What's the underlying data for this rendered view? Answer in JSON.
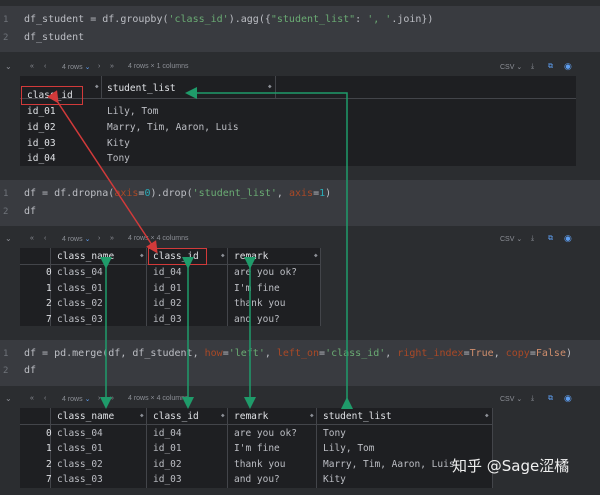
{
  "cell1": {
    "lines": [
      {
        "num": "1",
        "parts": [
          [
            "df_student = df.groupby(",
            ""
          ],
          [
            "'class_id'",
            "str"
          ],
          [
            ").agg({",
            ""
          ],
          [
            "\"student_list\"",
            "str"
          ],
          [
            ": ",
            ""
          ],
          [
            "', '",
            "str"
          ],
          [
            ".join})",
            ""
          ]
        ]
      },
      {
        "num": "2",
        "parts": [
          [
            "df_student",
            ""
          ]
        ]
      }
    ]
  },
  "out1": {
    "rows_label": "4 rows",
    "shape_label": "4 rows × 1 columns",
    "csv_label": "CSV",
    "index_header": "class_id",
    "columns": [
      "student_list"
    ],
    "rows": [
      {
        "index": "id_01",
        "cells": [
          "Lily, Tom"
        ]
      },
      {
        "index": "id_02",
        "cells": [
          "Marry, Tim, Aaron, Luis"
        ]
      },
      {
        "index": "id_03",
        "cells": [
          "Kity"
        ]
      },
      {
        "index": "id_04",
        "cells": [
          "Tony"
        ]
      }
    ]
  },
  "cell2": {
    "lines": [
      {
        "num": "1",
        "parts": [
          [
            "df = df.dropna(",
            ""
          ],
          [
            "axis",
            "kwarg"
          ],
          [
            "=",
            ""
          ],
          [
            "0",
            "num"
          ],
          [
            ").drop(",
            ""
          ],
          [
            "'student_list'",
            "str"
          ],
          [
            ", ",
            ""
          ],
          [
            "axis",
            "kwarg"
          ],
          [
            "=",
            ""
          ],
          [
            "1",
            "num"
          ],
          [
            ")",
            ""
          ]
        ]
      },
      {
        "num": "2",
        "parts": [
          [
            "df",
            ""
          ]
        ]
      }
    ]
  },
  "out2": {
    "rows_label": "4 rows",
    "shape_label": "4 rows × 4 columns",
    "csv_label": "CSV",
    "columns": [
      "class_name",
      "class_id",
      "remark"
    ],
    "rows": [
      {
        "index": "0",
        "cells": [
          "class_04",
          "id_04",
          "are you ok?"
        ]
      },
      {
        "index": "1",
        "cells": [
          "class_01",
          "id_01",
          "I'm fine"
        ]
      },
      {
        "index": "2",
        "cells": [
          "class_02",
          "id_02",
          "thank you"
        ]
      },
      {
        "index": "7",
        "cells": [
          "class_03",
          "id_03",
          "and you?"
        ]
      }
    ]
  },
  "cell3": {
    "lines": [
      {
        "num": "1",
        "parts": [
          [
            "df = pd.merge(df, df_student, ",
            ""
          ],
          [
            "how",
            "kwarg"
          ],
          [
            "=",
            ""
          ],
          [
            "'left'",
            "str"
          ],
          [
            ", ",
            ""
          ],
          [
            "left_on",
            "kwarg"
          ],
          [
            "=",
            ""
          ],
          [
            "'class_id'",
            "str"
          ],
          [
            ", ",
            ""
          ],
          [
            "right_index",
            "kwarg"
          ],
          [
            "=",
            ""
          ],
          [
            "True",
            "kw"
          ],
          [
            ", ",
            ""
          ],
          [
            "copy",
            "kwarg"
          ],
          [
            "=",
            ""
          ],
          [
            "False",
            "kw"
          ],
          [
            ")",
            ""
          ]
        ]
      },
      {
        "num": "2",
        "parts": [
          [
            "df",
            ""
          ]
        ]
      }
    ]
  },
  "out3": {
    "rows_label": "4 rows",
    "shape_label": "4 rows × 4 columns",
    "csv_label": "CSV",
    "columns": [
      "class_name",
      "class_id",
      "remark",
      "student_list"
    ],
    "rows": [
      {
        "index": "0",
        "cells": [
          "class_04",
          "id_04",
          "are you ok?",
          "Tony"
        ]
      },
      {
        "index": "1",
        "cells": [
          "class_01",
          "id_01",
          "I'm fine",
          "Lily, Tom"
        ]
      },
      {
        "index": "2",
        "cells": [
          "class_02",
          "id_02",
          "thank you",
          "Marry, Tim, Aaron, Luis"
        ]
      },
      {
        "index": "7",
        "cells": [
          "class_03",
          "id_03",
          "and you?",
          "Kity"
        ]
      }
    ]
  },
  "watermark": "知乎 @Sage涩橘",
  "colors": {
    "code_bg": "#393b40",
    "table_bg": "#1e1f22",
    "string": "#6aab73",
    "keyword": "#cf8e6d",
    "arrow_green": "#1f9b6a",
    "arrow_red": "#d23a3a"
  },
  "icons": [
    "chevron-down-icon",
    "first-page-icon",
    "prev-page-icon",
    "next-page-icon",
    "last-page-icon",
    "download-icon",
    "open-external-icon",
    "eye-icon"
  ]
}
